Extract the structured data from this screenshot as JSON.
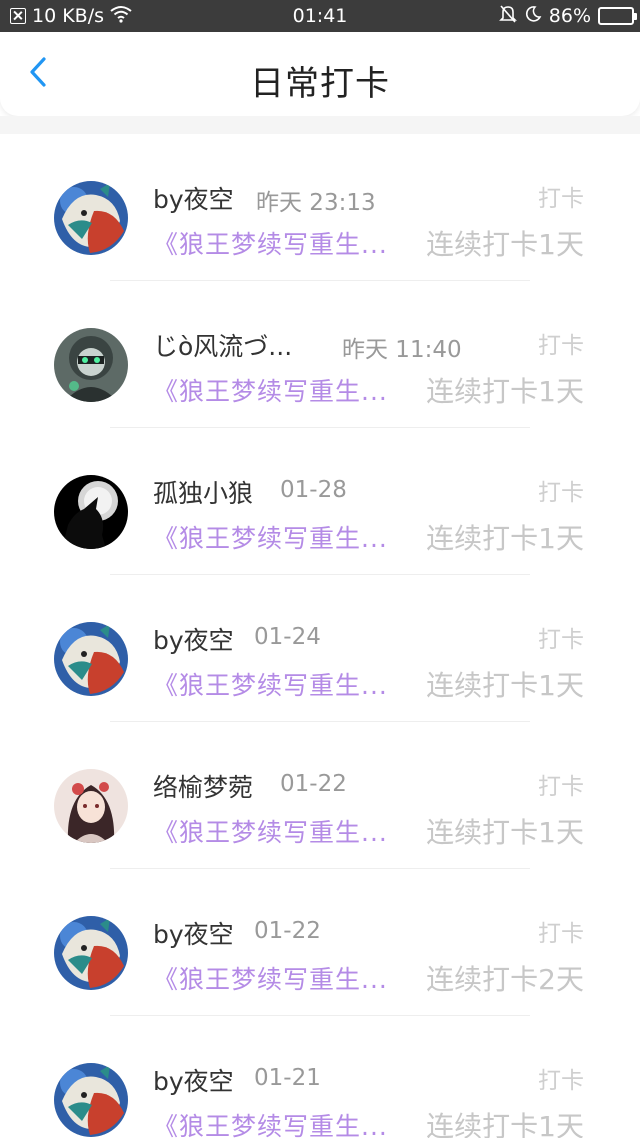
{
  "status_bar": {
    "speed": "10 KB/s",
    "time": "01:41",
    "battery": "86%",
    "battery_level": 0.86,
    "icons": [
      "screenshot-icon",
      "wifi-icon",
      "bell-muted-icon",
      "moon-icon",
      "battery-icon"
    ]
  },
  "header": {
    "title": "日常打卡",
    "back_icon": "chevron-left-icon",
    "accent": "#2196f3"
  },
  "colors": {
    "book_title": "#b48be6",
    "muted": "#c7c7c7"
  },
  "items": [
    {
      "name": "by夜空",
      "time": "昨天 23:13",
      "tag": "打卡",
      "book": "《狼王梦续写重生...",
      "streak": "连续打卡1天",
      "avatar": "wolf-avatar"
    },
    {
      "name": "じò风流づ...",
      "time": "昨天 11:40",
      "tag": "打卡",
      "book": "《狼王梦续写重生...",
      "streak": "连续打卡1天",
      "avatar": "masked-figure-avatar"
    },
    {
      "name": "孤独小狼",
      "time": "01-28",
      "tag": "打卡",
      "book": "《狼王梦续写重生...",
      "streak": "连续打卡1天",
      "avatar": "howling-wolf-avatar"
    },
    {
      "name": "by夜空",
      "time": "01-24",
      "tag": "打卡",
      "book": "《狼王梦续写重生...",
      "streak": "连续打卡1天",
      "avatar": "wolf-avatar"
    },
    {
      "name": "络榆梦菀",
      "time": "01-22",
      "tag": "打卡",
      "book": "《狼王梦续写重生...",
      "streak": "连续打卡1天",
      "avatar": "anime-girl-avatar"
    },
    {
      "name": "by夜空",
      "time": "01-22",
      "tag": "打卡",
      "book": "《狼王梦续写重生...",
      "streak": "连续打卡2天",
      "avatar": "wolf-avatar"
    },
    {
      "name": "by夜空",
      "time": "01-21",
      "tag": "打卡",
      "book": "《狼王梦续写重生...",
      "streak": "连续打卡1天",
      "avatar": "wolf-avatar"
    }
  ]
}
